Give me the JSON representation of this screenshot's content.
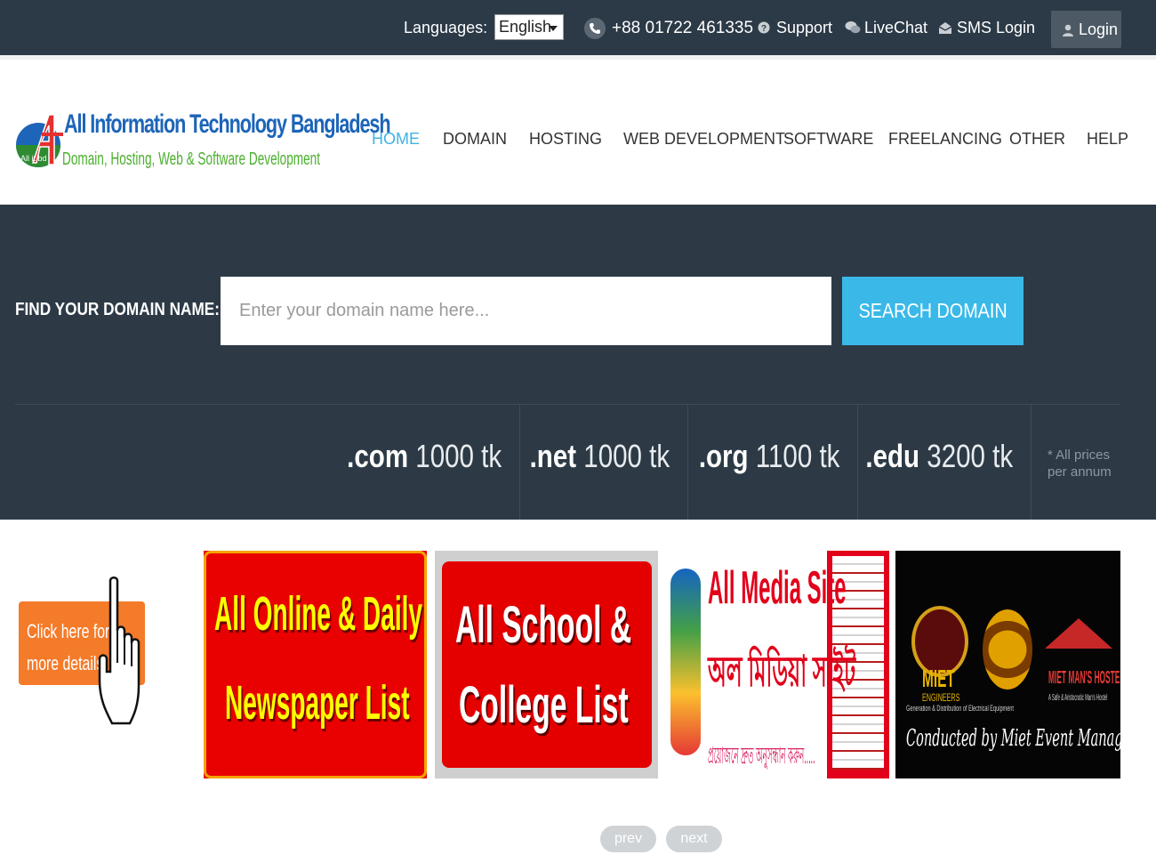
{
  "topbar": {
    "languages_label": "Languages:",
    "language_selected": "English",
    "phone": "+88 01722 461335",
    "support": "Support",
    "livechat": "LiveChat",
    "sms_login": "SMS Login",
    "login": "Login"
  },
  "logo": {
    "mark_text": "All it bd",
    "title": "All Information Technology Bangladesh",
    "subtitle": "Domain, Hosting, Web & Software Development"
  },
  "nav": {
    "items": [
      {
        "label": "HOME",
        "active": true
      },
      {
        "label": "DOMAIN"
      },
      {
        "label": "HOSTING"
      },
      {
        "label": "WEB DEVELOPMENT"
      },
      {
        "label": "SOFTWARE"
      },
      {
        "label": "FREELANCING"
      },
      {
        "label": "OTHER"
      },
      {
        "label": "HELP"
      }
    ]
  },
  "domain_search": {
    "label": "FIND YOUR DOMAIN NAME:",
    "placeholder": "Enter your domain name here...",
    "button": "SEARCH DOMAIN",
    "prices": [
      {
        "tld": ".com",
        "price": "1000 tk"
      },
      {
        "tld": ".net",
        "price": "1000 tk"
      },
      {
        "tld": ".org",
        "price": "1100 tk"
      },
      {
        "tld": ".edu",
        "price": "3200 tk"
      }
    ],
    "note_line1": "* All prices",
    "note_line2": "per annum"
  },
  "banners": {
    "click_here_line1": "Click here for",
    "click_here_line2": "more details",
    "slides": [
      {
        "line1": "All Online & Daily",
        "line2": "Newspaper List"
      },
      {
        "line1": "All School &",
        "line2": "College List"
      },
      {
        "line1": "All Media Site",
        "line2": "অল মিডিয়া সাইট",
        "line3": "প্রয়োজনে দ্রুত অনুসন্ধান করুন....."
      },
      {
        "brand1": "MIET",
        "brand1_sub": "ENGINEERS",
        "brand2": "MIET MAN'S HOSTEL",
        "brand2_sub": "A Safe & Aristocratic Man's Hostel",
        "small": "Generation & Distribution of Electrical Equipment",
        "footer": "Conducted by Miet Event Managment"
      }
    ],
    "prev": "prev",
    "next": "next"
  },
  "colors": {
    "topbar_bg": "#2c3a47",
    "accent": "#3ab9e8",
    "search_bg": "#2d3a46",
    "click_orange": "#f47b2a",
    "banner_red": "#e60000"
  }
}
